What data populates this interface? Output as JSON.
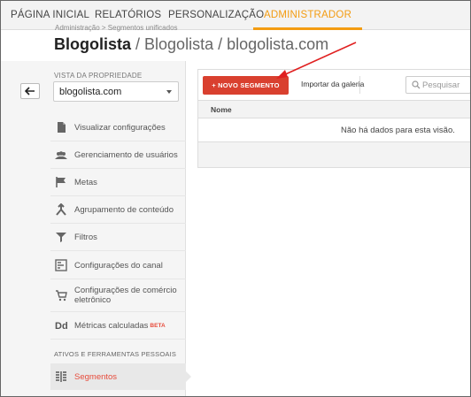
{
  "nav": {
    "tabs": [
      {
        "label": "PÁGINA INICIAL"
      },
      {
        "label": "RELATÓRIOS"
      },
      {
        "label": "PERSONALIZAÇÃO"
      },
      {
        "label": "ADMINISTRADOR"
      }
    ],
    "active_color": "#f39c12"
  },
  "header": {
    "breadcrumb": "Administração > Segmentos unificados",
    "title": "Blogolista",
    "subtitle": "/ Blogolista / blogolista.com"
  },
  "sidebar": {
    "property_label": "VISTA DA PROPRIEDADE",
    "property_value": "blogolista.com",
    "items": [
      {
        "label": "Visualizar configurações",
        "icon": "document-icon"
      },
      {
        "label": "Gerenciamento de usuários",
        "icon": "users-icon"
      },
      {
        "label": "Metas",
        "icon": "flag-icon"
      },
      {
        "label": "Agrupamento de conteúdo",
        "icon": "content-grouping-icon"
      },
      {
        "label": "Filtros",
        "icon": "filter-icon"
      },
      {
        "label": "Configurações do canal",
        "icon": "channel-settings-icon"
      },
      {
        "label": "Configurações de comércio eletrônico",
        "icon": "cart-icon"
      },
      {
        "label": "Métricas calculadas",
        "badge": "BETA",
        "icon": "calculated-metrics-icon"
      }
    ],
    "section_label": "ATIVOS E FERRAMENTAS PESSOAIS",
    "active_item": {
      "label": "Segmentos",
      "icon": "segments-icon"
    }
  },
  "toolbar": {
    "new_segment_label": "+ NOVO SEGMENTO",
    "gallery_label": "Importar da galeria",
    "search_placeholder": "Pesquisar",
    "accent": "#d9402f"
  },
  "table": {
    "column_header": "Nome",
    "empty_message": "Não há dados para esta visão."
  }
}
